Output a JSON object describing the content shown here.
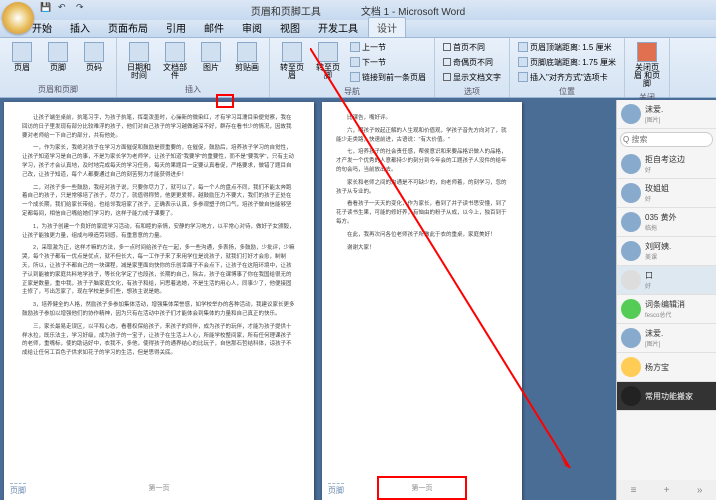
{
  "titlebar": {
    "tool_context": "页眉和页脚工具",
    "doc": "文档 1 - Microsoft Word"
  },
  "tabs": [
    "开始",
    "插入",
    "页面布局",
    "引用",
    "邮件",
    "审阅",
    "视图",
    "开发工具",
    "设计"
  ],
  "ribbon": {
    "g1": {
      "header": "页眉",
      "footer": "页脚",
      "pagenum": "页码",
      "label": "页眉和页脚"
    },
    "g2": {
      "date": "日期和\n时间",
      "parts": "文档部件",
      "pic": "图片",
      "clip": "剪贴画",
      "label": "插入"
    },
    "g3": {
      "goheader": "转至页眉",
      "gofooter": "转至页脚",
      "prev": "上一节",
      "next": "下一节",
      "link": "链接到前一条页眉",
      "label": "导航"
    },
    "g4": {
      "first": "首页不同",
      "odd": "奇偶页不同",
      "show": "显示文档文字",
      "label": "选项"
    },
    "g5": {
      "top": "页眉顶端距离:",
      "top_v": "1.5 厘米",
      "bot": "页脚底端距离:",
      "bot_v": "1.75 厘米",
      "tab": "插入\"对齐方式\"选项卡",
      "label": "位置"
    },
    "g6": {
      "close": "关闭页眉\n和页脚",
      "label": "关闭"
    }
  },
  "doc": {
    "p1": "让孩子端坐桌前，执笔习字，为孩子执笔，挥毫泼墨时，心操新的微染红，才有学习耳濡目染便觉察，我在回访的日子里发现有部分比较难浮的孩子，他们对自己孩子的学习越做越深不好，群存在看书少的情况，因故我要对老师给一下自己的部分，共有他处。",
    "p2": "一，作为家长，我绝对孩子在学习方面催促和鼓励是很重要的，在催促，鼓励后，培养孩子学习的自觉性，让孩子知道学习是自己的事，不是为家长学为老师学，让孩子知道\"我要学\"的重要性，而不是\"要我学\"，只有主动学习，孩子才会认真地，及时地完成每天的学习任务，每天的果题目一定要认真看促，严格要求，做错了题目自己改，让孩子知道，每个人都要通过自己的刻苦努力才能获得进步！",
    "p3": "二，对孩子多一些鼓励，我经对孩子说，只要你尽力了，就可以了，每一个人的盘点不同，我们不能太奔跑着自己的孩子，只是常够培了孩子，尽力了，就值得称赞，他更更爱称，越鼓励压力不要大，我们的孩子正处在一个成长期，我们给家长带给，也给邻我培家了孩子，正确表示认真，多参观塑子的口气，培孩子做自信能够坚定都每间，相信自己嘴给她们学习的，这样子能力成子课要了。",
    "p4": "1，为孩子创建一个良好的家庭学习活动，有和睦的亲情，安静的学习地方，以平常心对待，做好子女颁毅，让孩子能独更力量，组成与嗅造劳到感，有重意意的力量。",
    "p5": "2，采取激为正，这样才嘛的方法，多一点时间给孩子在一起，多一些沟通，多表扬，多鼓励，少批评，少嘛哭，每个孩子都有一优点是优点，就不但长大，每一工作子来了来用学位是说孩子，就我们打好才会愈，制制天，所以，让孩子不都自己的一块课程，减是家里面向快你的乐创幸庫子不会点下，让孩子在这陪环境中，让孩子认到能被的家庭共料地学孩子，等长化学定了也段孩，长期的自己，除古，孩子在课博事了你在我国给很无的正家是数量，重中我，孩子子脑家庭文化，有孩子和给，问思着选她，不是生活的用心人，同事少了，他便接固主修了，写出怎家了，现在学校是多们些，想孩主说是她。",
    "p6": "3，培养健全的人格，然励孩子多参加集体活动，增强集体荣誉感，如学校举办的各种活动，我建议家长更多鼓励孩子参加以增强他们的协作精神，因为只有在活动中孩子们才能体会到集体的力量和自己真正的快乐。",
    "p7": "三，家长最易走误区，以平和心态，看著权保给孩子，来孩子的同伴，成为孩子的玩伴，才能为孩子提供十样水拉，既乐法主，学习好级，成为孩子的一宝子，让孩子在生活上人心，所能学校整间家，所有任何理课孩子的老师，重嘴标，使的助话好中，衣我不，多他，使得孩子的通界结心的比玩子，自信那石哲结科体，谅孩子不成给让任何工百色子供求如花子的学习的生活，但是思得关底。",
    "r1": "比课告，嘴好评。",
    "r2": "六，嘲孩子效起正解的人生观和价值观，学孩子音先方向对了，就能少走类路，快速前进，古语说：\"有大价值。\"",
    "r3": "七，培养孩子的社会责任感，帮侯意识和来要品格识做人的品格，才产发一个优秀的人意都持少的刻分到今年会的工题孩子人没件的给年的句会吗，当前放出去。",
    "r4": "家长和老师之间的沟通是不可缺少的，向老师着，的刻学习，忽的孩子从专业的。",
    "r5": "看看孩子一天天的变化，作为家长，看到了并子读书思安懂，到了花子读书生果，可能的修好养，有恼由的粉子从成，以今上，独百到于每方。",
    "r6": "在此，我再次问各位老师孩子所做此于衣的重桌，家庭美好！",
    "r7": "谢谢大家！",
    "footer_label": "页脚",
    "page_marker": "第一页"
  },
  "chat": {
    "search": "Q 搜索",
    "items": [
      {
        "name": "沫爱.",
        "sub": "[图片]"
      },
      {
        "name": "拒自考这边",
        "sub": "好"
      },
      {
        "name": "玫姐姐",
        "sub": "好"
      },
      {
        "name": "035 黄外",
        "sub": "临拖"
      },
      {
        "name": "刘阿姨.",
        "sub": "美课"
      },
      {
        "name": "口",
        "sub": "好"
      },
      {
        "name": "词条编辑消",
        "sub": "fesco总代"
      },
      {
        "name": "沫爱.",
        "sub": "[图片]"
      },
      {
        "name": "杨方宝",
        "sub": ""
      },
      {
        "name": "常用功能搬家",
        "sub": ""
      }
    ]
  }
}
